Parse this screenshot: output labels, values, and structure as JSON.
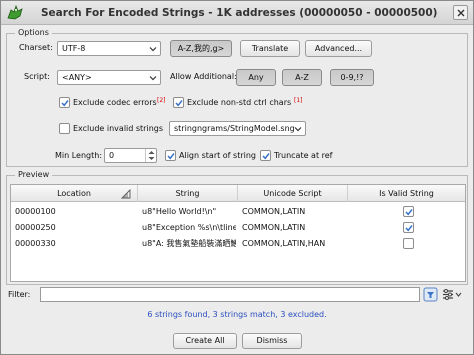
{
  "window": {
    "title": "Search For Encoded Strings - 1K addresses (00000050 - 00000500)"
  },
  "options": {
    "legend": "Options",
    "charset_label": "Charset:",
    "charset_value": "UTF-8",
    "btn_az_combo": "A-Z,我的,ǥ>",
    "btn_translate": "Translate",
    "btn_advanced": "Advanced...",
    "script_label": "Script:",
    "script_value": "<ANY>",
    "allow_additional_label": "Allow Additional:",
    "btn_any": "Any",
    "btn_az": "A-Z",
    "btn_09": "0-9,!?",
    "exclude_codec_label": "Exclude codec errors",
    "exclude_codec_count": "[2]",
    "exclude_nonstd_label": "Exclude non-std ctrl chars",
    "exclude_nonstd_count": "[1]",
    "exclude_invalid_label": "Exclude invalid strings",
    "model_value": "stringngrams/StringModel.sng",
    "min_length_label": "Min Length:",
    "min_length_value": "0",
    "align_label": "Align start of string",
    "truncate_label": "Truncate at ref",
    "checks": {
      "exclude_codec": true,
      "exclude_nonstd": true,
      "exclude_invalid": false,
      "align": true,
      "truncate": true
    }
  },
  "preview": {
    "legend": "Preview",
    "columns": [
      "Location",
      "String",
      "Unicode Script",
      "Is Valid String"
    ],
    "rows": [
      {
        "location": "00000100",
        "string": "u8\"Hello World!\\n\"",
        "script": "COMMON,LATIN",
        "valid": true
      },
      {
        "location": "00000250",
        "string": "u8\"Exception %s\\n\\tline: ...",
        "script": "COMMON,LATIN",
        "valid": true
      },
      {
        "location": "00000330",
        "string": "u8\"A: 我售氣墊船裝滿晒鱔\"",
        "script": "COMMON,LATIN,HAN",
        "valid": false
      }
    ]
  },
  "filter": {
    "label": "Filter:",
    "value": ""
  },
  "status": "6 strings found, 3 strings match, 3 excluded.",
  "buttons": {
    "create_all": "Create All",
    "dismiss": "Dismiss"
  },
  "colors": {
    "status_text": "#2b4fbf",
    "warning": "#d40000",
    "selection_blue": "#3b74c9"
  }
}
